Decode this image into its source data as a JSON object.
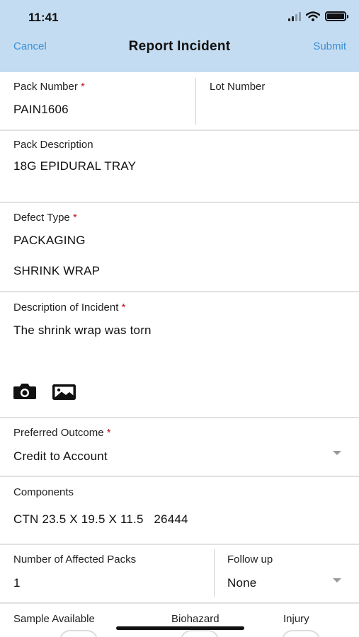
{
  "status": {
    "time": "11:41"
  },
  "nav": {
    "cancel": "Cancel",
    "title": "Report Incident",
    "submit": "Submit"
  },
  "required_marker": "*",
  "pack_number": {
    "label": "Pack Number",
    "value": "PAIN1606"
  },
  "lot_number": {
    "label": "Lot Number",
    "value": ""
  },
  "pack_description": {
    "label": "Pack Description",
    "value": "18G EPIDURAL TRAY"
  },
  "defect_type": {
    "label": "Defect Type",
    "category": "PACKAGING",
    "subtype": "SHRINK WRAP"
  },
  "description": {
    "label": "Description of Incident",
    "value": "The shrink wrap was torn"
  },
  "attach_icons": [
    "camera-icon",
    "image-icon"
  ],
  "preferred_outcome": {
    "label": "Preferred Outcome",
    "value": "Credit to Account"
  },
  "components": {
    "label": "Components",
    "value": "CTN 23.5 X 19.5 X 11.5   26444"
  },
  "affected_packs": {
    "label": "Number of Affected Packs",
    "value": "1"
  },
  "follow_up": {
    "label": "Follow up",
    "value": "None"
  },
  "toggles": {
    "sample": "Sample Available",
    "biohazard": "Biohazard",
    "injury": "Injury"
  },
  "colors": {
    "header_bg": "#c4dcf1",
    "link": "#3a8fd8",
    "required": "#c0161f"
  }
}
